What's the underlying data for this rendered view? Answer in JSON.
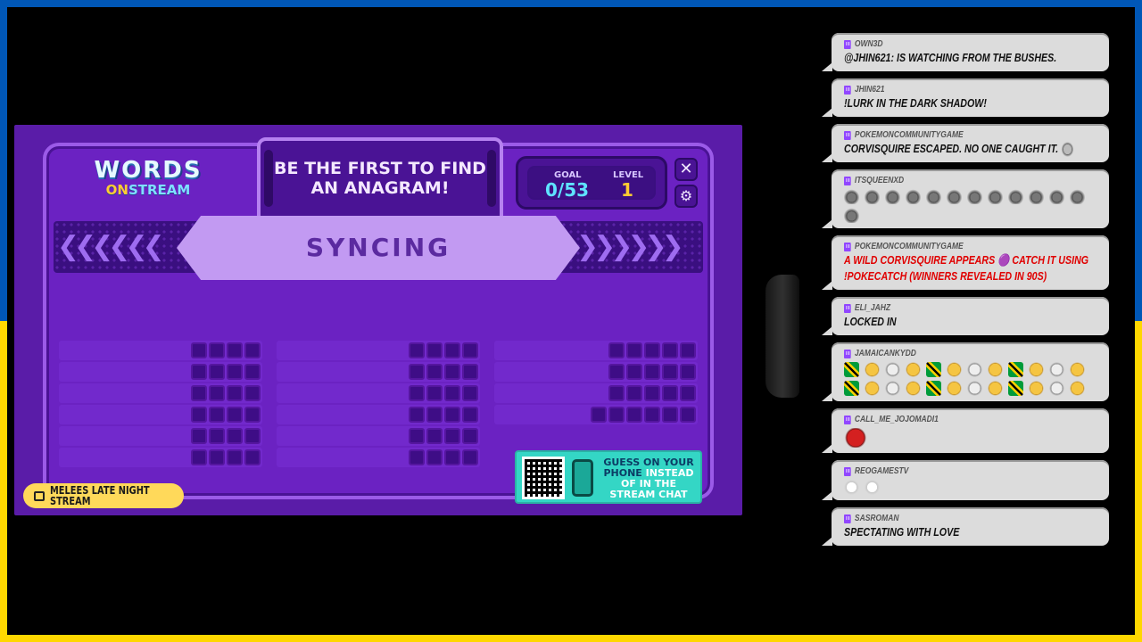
{
  "game": {
    "logo_words": "WORDS",
    "logo_on": "ON",
    "logo_stream": "STREAM",
    "prompt": "BE THE FIRST TO FIND AN ANAGRAM!",
    "goal_label": "GOAL",
    "goal_value": "0/53",
    "level_label": "LEVEL",
    "level_value": "1",
    "close_icon": "✕",
    "gear_icon": "⚙",
    "status": "SYNCING",
    "qr_text_a": "GUESS ON YOUR PHONE",
    "qr_text_b": "INSTEAD OF IN THE STREAM CHAT",
    "stream_tag": "MELEES LATE NIGHT STREAM",
    "word_columns": [
      {
        "rows": [
          4,
          4,
          4,
          4,
          4,
          4
        ]
      },
      {
        "rows": [
          4,
          4,
          4,
          4,
          4,
          4
        ]
      },
      {
        "rows": [
          5,
          5,
          5,
          6
        ]
      }
    ]
  },
  "chat": [
    {
      "user": "OWN3D",
      "text": "@JHIN621: IS WATCHING FROM THE BUSHES."
    },
    {
      "user": "JHIN621",
      "text": "!LURK IN THE DARK SHADOW!"
    },
    {
      "user": "POKEMONCOMMUNITYGAME",
      "text": "CORVISQUIRE ESCAPED. NO ONE CAUGHT IT."
    },
    {
      "user": "ITSQUEENXD",
      "text": ""
    },
    {
      "user": "POKEMONCOMMUNITYGAME",
      "text": "A WILD CORVISQUIRE APPEARS 🟣 CATCH IT USING !POKECATCH (WINNERS REVEALED IN 90S)"
    },
    {
      "user": "ELI_JAHZ",
      "text": "LOCKED IN"
    },
    {
      "user": "JAMAICANKYDD",
      "text": ""
    },
    {
      "user": "CALL_ME_JOJOMADI1",
      "text": ""
    },
    {
      "user": "REOGAMESTV",
      "text": ""
    },
    {
      "user": "SASROMAN",
      "text": "SPECTATING WITH LOVE"
    }
  ]
}
